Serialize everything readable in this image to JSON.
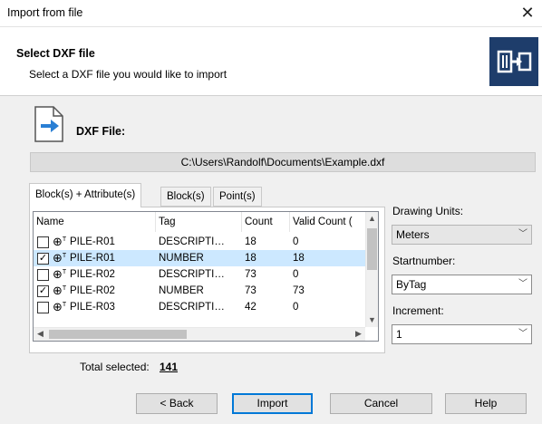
{
  "window": {
    "title": "Import from file",
    "close_glyph": "✕"
  },
  "header": {
    "title": "Select DXF file",
    "subtitle": "Select a DXF file you would like to import",
    "logo_icon": "import-logo-icon"
  },
  "file": {
    "label": "DXF File:",
    "path": "C:\\Users\\Randolf\\Documents\\Example.dxf"
  },
  "tabs": [
    {
      "label": "Block(s) + Attribute(s)",
      "active": true
    },
    {
      "label": "Block(s)",
      "active": false
    },
    {
      "label": "Point(s)",
      "active": false
    }
  ],
  "table": {
    "columns": [
      "Name",
      "Tag",
      "Count",
      "Valid Count ("
    ],
    "rows": [
      {
        "checked": false,
        "name": "PILE-R01",
        "tag": "DESCRIPTI…",
        "count": "18",
        "valid": "0",
        "selected": false
      },
      {
        "checked": true,
        "name": "PILE-R01",
        "tag": "NUMBER",
        "count": "18",
        "valid": "18",
        "selected": true
      },
      {
        "checked": false,
        "name": "PILE-R02",
        "tag": "DESCRIPTI…",
        "count": "73",
        "valid": "0",
        "selected": false
      },
      {
        "checked": true,
        "name": "PILE-R02",
        "tag": "NUMBER",
        "count": "73",
        "valid": "73",
        "selected": false
      },
      {
        "checked": false,
        "name": "PILE-R03",
        "tag": "DESCRIPTI…",
        "count": "42",
        "valid": "0",
        "selected": false
      }
    ]
  },
  "side": {
    "drawing_units_label": "Drawing Units:",
    "drawing_units_value": "Meters",
    "startnumber_label": "Startnumber:",
    "startnumber_value": "ByTag",
    "increment_label": "Increment:",
    "increment_value": "1"
  },
  "summary": {
    "label": "Total selected:",
    "value": "141"
  },
  "buttons": {
    "back": "< Back",
    "import": "Import",
    "cancel": "Cancel",
    "help": "Help"
  }
}
